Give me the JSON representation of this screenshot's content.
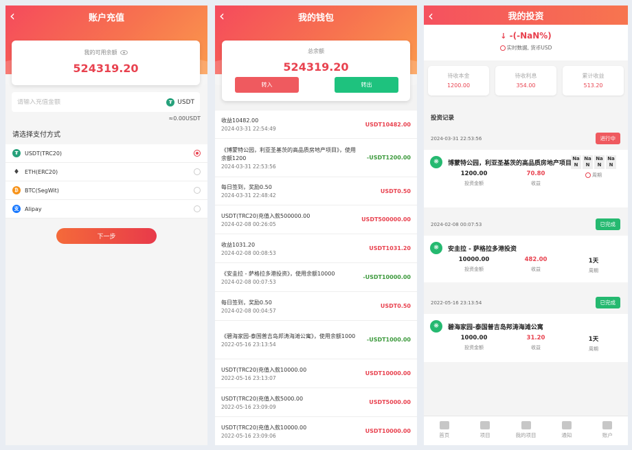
{
  "recharge": {
    "title": "账户充值",
    "balance_label": "我的可用余额",
    "balance": "524319.20",
    "amount_placeholder": "请输入充值金额",
    "currency": "USDT",
    "approx": "≈0.00USDT",
    "pay_title": "请选择支付方式",
    "methods": [
      {
        "name": "USDT(TRC20)",
        "icon": "usdt-icon",
        "selected": true
      },
      {
        "name": "ETH(ERC20)",
        "icon": "eth-icon",
        "selected": false
      },
      {
        "name": "BTC(SegWit)",
        "icon": "btc-icon",
        "selected": false
      },
      {
        "name": "Alipay",
        "icon": "alipay-icon",
        "selected": false
      }
    ],
    "next_label": "下一步"
  },
  "wallet": {
    "title": "我的钱包",
    "total_label": "总余额",
    "total": "524319.20",
    "in_label": "转入",
    "out_label": "转出",
    "records": [
      {
        "desc": "收益10482.00",
        "time": "2024-03-31 22:54:49",
        "amount": "USDT10482.00",
        "color": "red"
      },
      {
        "desc": "《博蒙特公园，利亚圣基茨的高品质房地产项目》，使用余额1200",
        "time": "2024-03-31 22:53:56",
        "amount": "-USDT1200.00",
        "color": "green"
      },
      {
        "desc": "每日签到，奖励0.50",
        "time": "2024-03-31 22:48:42",
        "amount": "USDT0.50",
        "color": "red"
      },
      {
        "desc": "USDT(TRC20)充值入款500000.00",
        "time": "2024-02-08 00:26:05",
        "amount": "USDT500000.00",
        "color": "red"
      },
      {
        "desc": "收益1031.20",
        "time": "2024-02-08 00:08:53",
        "amount": "USDT1031.20",
        "color": "red"
      },
      {
        "desc": "《安圭拉 - 萨格拉多港投资》，使用余额10000",
        "time": "2024-02-08 00:07:53",
        "amount": "-USDT10000.00",
        "color": "green"
      },
      {
        "desc": "每日签到，奖励0.50",
        "time": "2024-02-08 00:04:57",
        "amount": "USDT0.50",
        "color": "red"
      },
      {
        "desc": "《碧海家园-泰国普吉岛邦涛海滩公寓》，使用余额1000",
        "time": "2022-05-16 23:13:54",
        "amount": "-USDT1000.00",
        "color": "green"
      },
      {
        "desc": "USDT(TRC20)充值入款10000.00",
        "time": "2022-05-16 23:13:07",
        "amount": "USDT10000.00",
        "color": "red"
      },
      {
        "desc": "USDT(TRC20)充值入款5000.00",
        "time": "2022-05-16 23:09:09",
        "amount": "USDT5000.00",
        "color": "red"
      },
      {
        "desc": "USDT(TRC20)充值入款10000.00",
        "time": "2022-05-16 23:09:06",
        "amount": "USDT10000.00",
        "color": "red"
      }
    ]
  },
  "invest": {
    "title": "我的投资",
    "percent": "-(-NaN%)",
    "realtime": "实时数据, 货币USD",
    "stats": [
      {
        "label": "待收本金",
        "value": "1200.00"
      },
      {
        "label": "待收利息",
        "value": "354.00"
      },
      {
        "label": "累计收益",
        "value": "513.20"
      }
    ],
    "records_title": "投资记录",
    "items": [
      {
        "date": "2024-03-31 22:53:56",
        "status": "进行中",
        "status_color": "red",
        "name": "博蒙特公园，利亚圣基茨的高品质房地产项目",
        "amount": "1200.00",
        "amount_label": "投资金额",
        "profit": "70.80",
        "profit_label": "收益",
        "period": "",
        "period_label": "周期",
        "countdown": [
          "Na",
          "N",
          "Na",
          "N",
          "Na",
          "N",
          "Na",
          "N"
        ]
      },
      {
        "date": "2024-02-08 00:07:53",
        "status": "已完成",
        "status_color": "green",
        "name": "安圭拉 - 萨格拉多港投资",
        "amount": "10000.00",
        "amount_label": "投资金额",
        "profit": "482.00",
        "profit_label": "收益",
        "period": "1天",
        "period_label": "周期"
      },
      {
        "date": "2022-05-16 23:13:54",
        "status": "已完成",
        "status_color": "green",
        "name": "碧海家园-泰国普吉岛邦涛海滩公寓",
        "amount": "1000.00",
        "amount_label": "投资金额",
        "profit": "31.20",
        "profit_label": "收益",
        "period": "1天",
        "period_label": "周期"
      }
    ],
    "tabs": [
      "首页",
      "项目",
      "我的项目",
      "通知",
      "账户"
    ]
  },
  "colors": {
    "accent": "#e8424f",
    "green": "#25b970",
    "orange": "#f7734f"
  }
}
